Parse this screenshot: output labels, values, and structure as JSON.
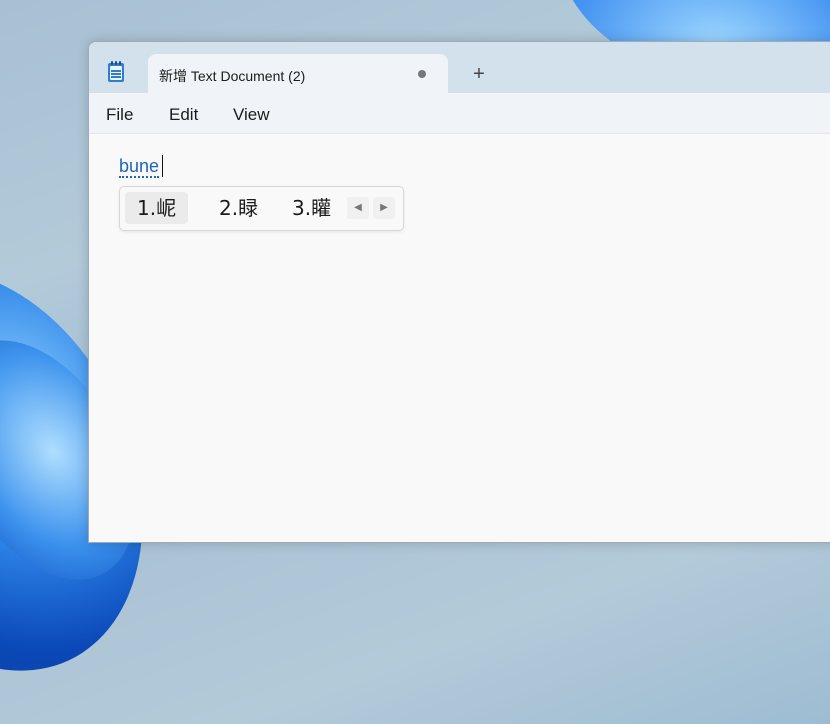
{
  "tab": {
    "title": "新增 Text Document (2)"
  },
  "menu": {
    "items": [
      "File",
      "Edit",
      "View"
    ]
  },
  "editor": {
    "composition_text": "bune"
  },
  "ime": {
    "candidates": [
      "1.㞾",
      "2.睩",
      "3.矔"
    ],
    "selected_index": 0
  },
  "icons": {
    "app": "notepad-icon",
    "unsaved": "unsaved-dot-icon",
    "new_tab": "plus-icon",
    "prev": "caret-left-icon",
    "next": "caret-right-icon"
  },
  "colors": {
    "accent": "#1e66b6",
    "titlebar": "#d3e1ec",
    "menubar": "#f0f4f8"
  }
}
